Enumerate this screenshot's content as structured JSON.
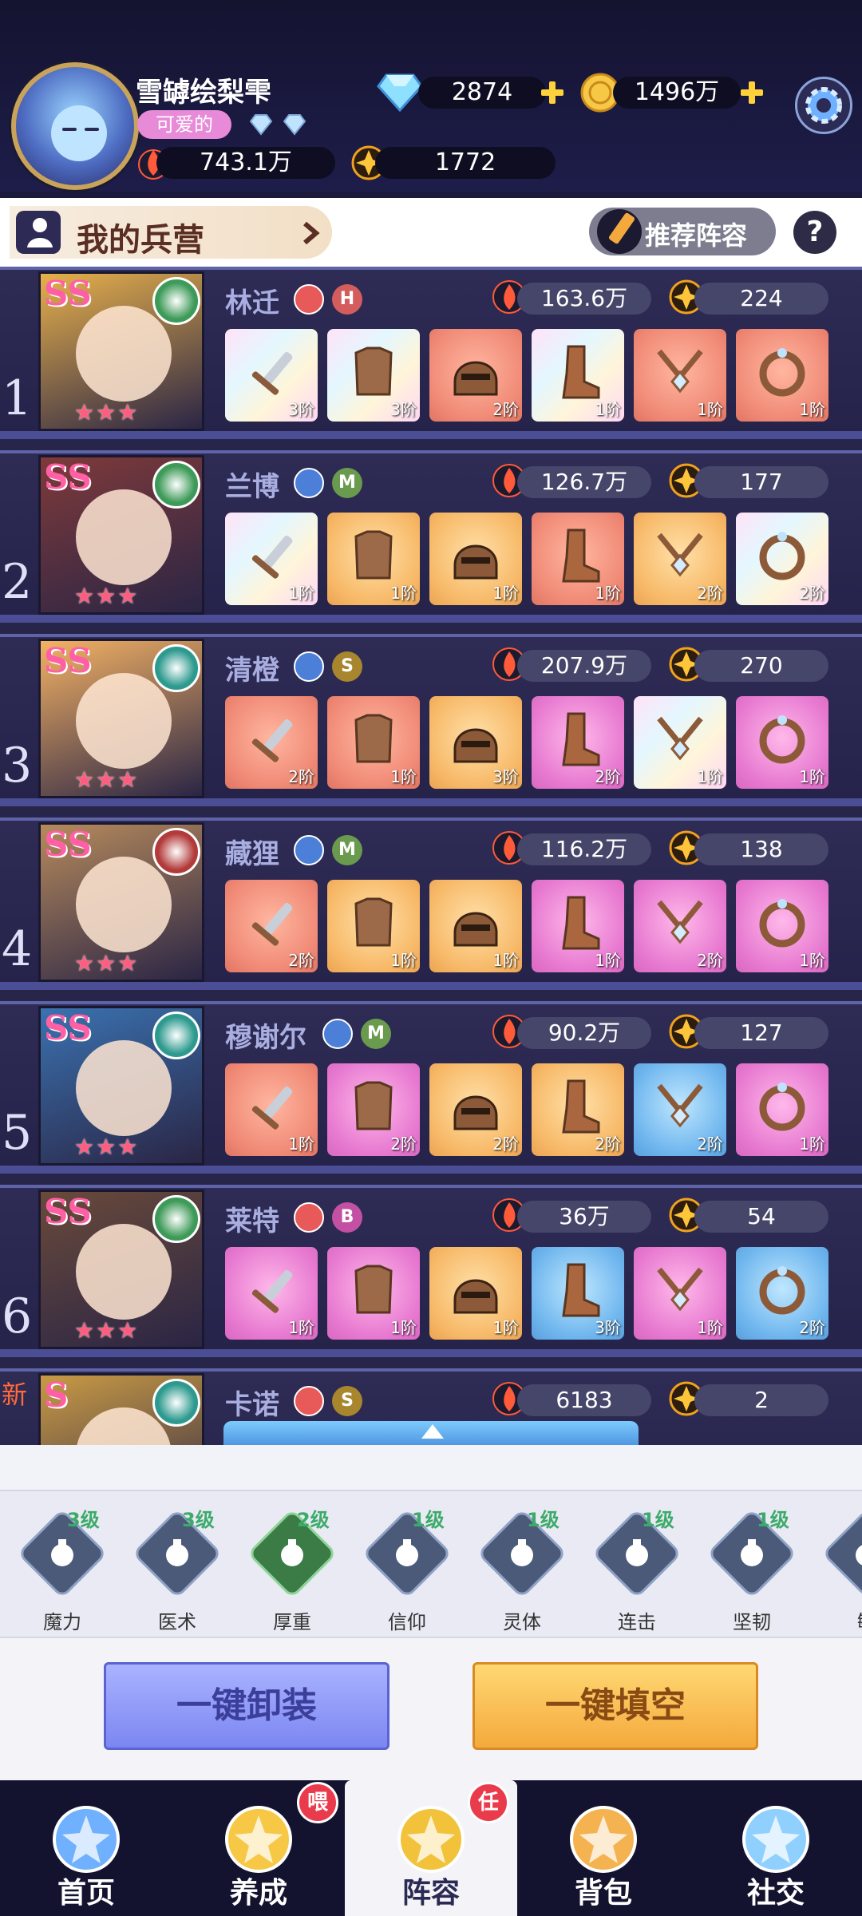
{
  "player": {
    "name": "雪罅绘梨雫",
    "tag": "可爱的",
    "diamonds": "2874",
    "gold": "1496万",
    "power": "743.1万",
    "stars": "1772"
  },
  "section": {
    "title": "我的兵营",
    "recommend_label": "推荐阵容",
    "help_label": "?"
  },
  "heroes": [
    {
      "rank": "1",
      "grade": "SS",
      "name": "林迁",
      "class_badge": "H",
      "power": "163.6万",
      "stars": "224",
      "equipment": [
        {
          "slot": "weapon",
          "tier": "3阶",
          "quality": "rainbow"
        },
        {
          "slot": "armor",
          "tier": "3阶",
          "quality": "rainbow"
        },
        {
          "slot": "helmet",
          "tier": "2阶",
          "quality": "red"
        },
        {
          "slot": "boots",
          "tier": "1阶",
          "quality": "rainbow"
        },
        {
          "slot": "necklace",
          "tier": "1阶",
          "quality": "red"
        },
        {
          "slot": "ring",
          "tier": "1阶",
          "quality": "red"
        }
      ]
    },
    {
      "rank": "2",
      "grade": "SS",
      "name": "兰博",
      "class_badge": "M",
      "power": "126.7万",
      "stars": "177",
      "equipment": [
        {
          "slot": "weapon",
          "tier": "1阶",
          "quality": "rainbow"
        },
        {
          "slot": "armor",
          "tier": "1阶",
          "quality": "orange"
        },
        {
          "slot": "helmet",
          "tier": "1阶",
          "quality": "orange"
        },
        {
          "slot": "boots",
          "tier": "1阶",
          "quality": "red"
        },
        {
          "slot": "necklace",
          "tier": "2阶",
          "quality": "orange"
        },
        {
          "slot": "ring",
          "tier": "2阶",
          "quality": "rainbow"
        }
      ]
    },
    {
      "rank": "3",
      "grade": "SS",
      "name": "清橙",
      "class_badge": "S",
      "power": "207.9万",
      "stars": "270",
      "equipment": [
        {
          "slot": "weapon",
          "tier": "2阶",
          "quality": "red"
        },
        {
          "slot": "armor",
          "tier": "1阶",
          "quality": "red"
        },
        {
          "slot": "helmet",
          "tier": "3阶",
          "quality": "orange"
        },
        {
          "slot": "boots",
          "tier": "2阶",
          "quality": "pink"
        },
        {
          "slot": "necklace",
          "tier": "1阶",
          "quality": "rainbow"
        },
        {
          "slot": "ring",
          "tier": "1阶",
          "quality": "pink"
        }
      ]
    },
    {
      "rank": "4",
      "grade": "SS",
      "name": "藏狸",
      "class_badge": "M",
      "power": "116.2万",
      "stars": "138",
      "equipment": [
        {
          "slot": "weapon",
          "tier": "2阶",
          "quality": "red"
        },
        {
          "slot": "armor",
          "tier": "1阶",
          "quality": "orange"
        },
        {
          "slot": "helmet",
          "tier": "1阶",
          "quality": "orange"
        },
        {
          "slot": "boots",
          "tier": "1阶",
          "quality": "pink"
        },
        {
          "slot": "necklace",
          "tier": "2阶",
          "quality": "pink"
        },
        {
          "slot": "ring",
          "tier": "1阶",
          "quality": "pink"
        }
      ]
    },
    {
      "rank": "5",
      "grade": "SS",
      "name": "穆谢尔",
      "class_badge": "M",
      "power": "90.2万",
      "stars": "127",
      "equipment": [
        {
          "slot": "weapon",
          "tier": "1阶",
          "quality": "red"
        },
        {
          "slot": "armor",
          "tier": "2阶",
          "quality": "pink"
        },
        {
          "slot": "helmet",
          "tier": "2阶",
          "quality": "orange"
        },
        {
          "slot": "boots",
          "tier": "2阶",
          "quality": "orange"
        },
        {
          "slot": "necklace",
          "tier": "2阶",
          "quality": "blue"
        },
        {
          "slot": "ring",
          "tier": "1阶",
          "quality": "pink"
        }
      ]
    },
    {
      "rank": "6",
      "grade": "SS",
      "name": "莱特",
      "class_badge": "B",
      "power": "36万",
      "stars": "54",
      "equipment": [
        {
          "slot": "weapon",
          "tier": "1阶",
          "quality": "pink"
        },
        {
          "slot": "armor",
          "tier": "1阶",
          "quality": "pink"
        },
        {
          "slot": "helmet",
          "tier": "1阶",
          "quality": "orange"
        },
        {
          "slot": "boots",
          "tier": "3阶",
          "quality": "blue"
        },
        {
          "slot": "necklace",
          "tier": "1阶",
          "quality": "pink"
        },
        {
          "slot": "ring",
          "tier": "2阶",
          "quality": "blue"
        }
      ]
    },
    {
      "rank": "新",
      "grade": "S",
      "name": "卡诺",
      "class_badge": "S",
      "power": "6183",
      "stars": "2",
      "equipment": []
    }
  ],
  "skills": [
    {
      "name": "魔力",
      "level": "3级",
      "icon": "potion-icon"
    },
    {
      "name": "医术",
      "level": "3级",
      "icon": "heal-sparkle-icon"
    },
    {
      "name": "厚重",
      "level": "2级",
      "icon": "shield-icon"
    },
    {
      "name": "信仰",
      "level": "1级",
      "icon": "halo-icon"
    },
    {
      "name": "灵体",
      "level": "1级",
      "icon": "spirit-icon"
    },
    {
      "name": "连击",
      "level": "1级",
      "icon": "combo-icon"
    },
    {
      "name": "坚韧",
      "level": "1级",
      "icon": "gauge-icon"
    },
    {
      "name": "敏",
      "level": "",
      "icon": "agility-icon"
    }
  ],
  "actions": {
    "unequip_all": "一键卸装",
    "fill_all": "一键填空"
  },
  "nav": [
    {
      "label": "首页",
      "icon": "home-castle-icon",
      "badge": ""
    },
    {
      "label": "养成",
      "icon": "star-train-icon",
      "badge": "喂"
    },
    {
      "label": "阵容",
      "icon": "formation-star-icon",
      "badge": "任"
    },
    {
      "label": "背包",
      "icon": "bag-icon",
      "badge": ""
    },
    {
      "label": "社交",
      "icon": "social-mascot-icon",
      "badge": ""
    }
  ],
  "colors": {
    "background": "#1b1a3c",
    "accent_pink": "#ff5fa4",
    "unequip_btn": "#7c86f2",
    "fill_btn": "#f4a93c",
    "level_green": "#3caa6a"
  }
}
